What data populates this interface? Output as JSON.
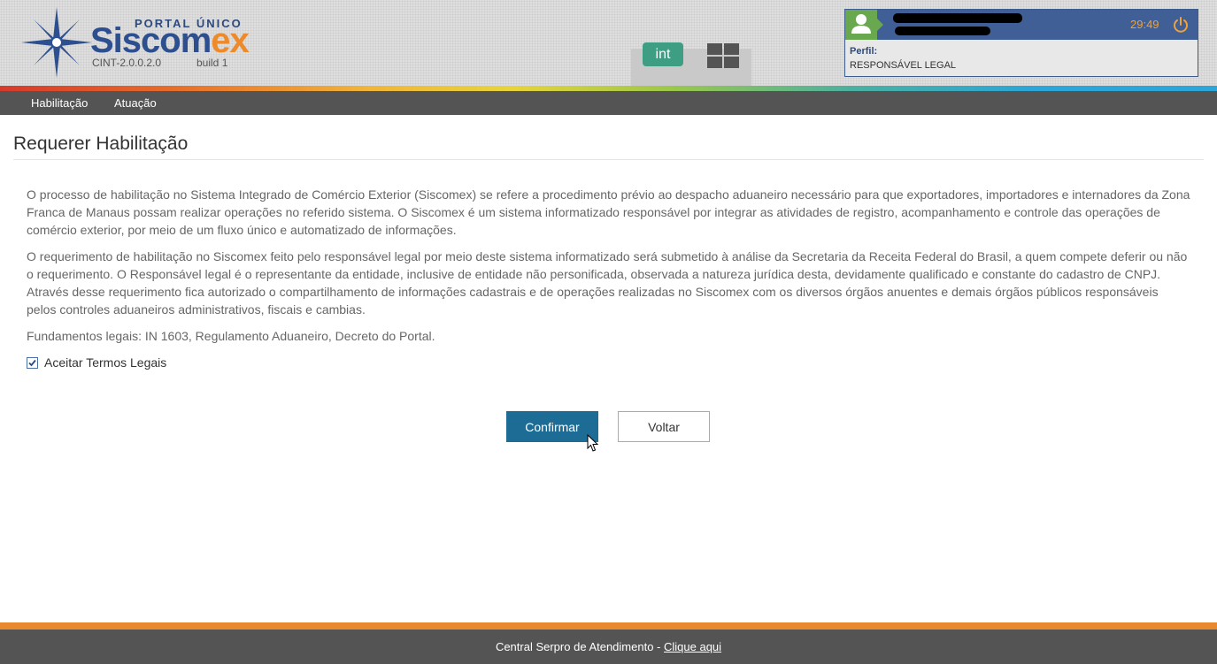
{
  "header": {
    "portal_label": "PORTAL ÚNICO",
    "brand_blue": "Siscom",
    "brand_orange": "ex",
    "version": "CINT-2.0.0.2.0",
    "build": "build 1",
    "environment": "int"
  },
  "user": {
    "timer": "29:49",
    "profile_label": "Perfil:",
    "profile_value": "RESPONSÁVEL LEGAL"
  },
  "nav": {
    "items": [
      {
        "label": "Habilitação"
      },
      {
        "label": "Atuação"
      }
    ]
  },
  "main": {
    "title": "Requerer Habilitação",
    "paragraph1": "O processo de habilitação no Sistema Integrado de Comércio Exterior (Siscomex) se refere a procedimento prévio ao despacho aduaneiro necessário para que exportadores, importadores e internadores da Zona Franca de Manaus possam realizar operações no referido sistema. O Siscomex é um sistema informatizado responsável por integrar as atividades de registro, acompanhamento e controle das operações de comércio exterior, por meio de um fluxo único e automatizado de informações.",
    "paragraph2": "O requerimento de habilitação no Siscomex feito pelo responsável legal por meio deste sistema informatizado será submetido à análise da Secretaria da Receita Federal do Brasil, a quem compete deferir ou não o requerimento. O Responsável legal é o representante da entidade, inclusive de entidade não personificada, observada a natureza jurídica desta, devidamente qualificado e constante do cadastro de CNPJ. Através desse requerimento fica autorizado o compartilhamento de informações cadastrais e de operações realizadas no Siscomex com os diversos órgãos anuentes e demais órgãos públicos responsáveis pelos controles aduaneiros administrativos, fiscais e cambias.",
    "paragraph3": "Fundamentos legais: IN 1603, Regulamento Aduaneiro, Decreto do Portal.",
    "terms_label": "Aceitar Termos Legais",
    "terms_checked": true,
    "confirm_label": "Confirmar",
    "back_label": "Voltar"
  },
  "footer": {
    "text": "Central Serpro de Atendimento - ",
    "link_label": "Clique aqui"
  },
  "colors": {
    "primary_button": "#1c6c96",
    "nav_bg": "#545454",
    "footer_accent": "#e8892f",
    "brand_blue": "#2e4f8f",
    "brand_orange": "#ef8a2a"
  }
}
